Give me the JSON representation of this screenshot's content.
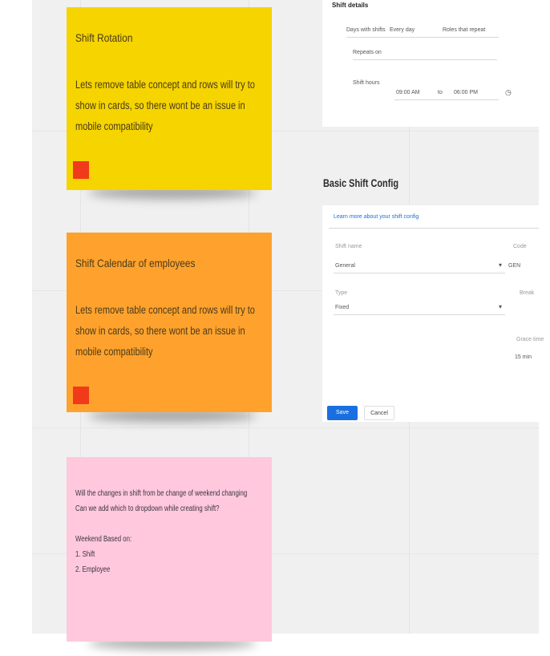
{
  "stickies": [
    {
      "title": "Shift Rotation",
      "body": "Lets remove table concept and rows will try to show in cards, so there wont be an issue in mobile compatibility"
    },
    {
      "title": "Shift Calendar of employees",
      "body": "Lets remove table concept and rows will try to show in cards, so there wont be an issue in mobile compatibility"
    },
    {
      "lines": [
        "Will the changes in shift from be change of weekend changing",
        "Can we add which to dropdown while creating shift?",
        "",
        "Weekend Based on:",
        "1. Shift",
        "2. Employee"
      ]
    }
  ],
  "top_panel": {
    "title": "Shift details",
    "row1_label": "Days with shifts",
    "row1_value": "Every day",
    "row1_right": "Roles that repeat",
    "row2_label": "Repeats on",
    "row3_label": "Shift hours",
    "row3_start": "09:00 AM",
    "row3_sep": "to",
    "row3_end": "06:00 PM"
  },
  "config": {
    "heading": "Basic Shift Config",
    "link": "Learn more about your shift config",
    "field1_label": "Shift name",
    "field1_value": "General",
    "field1_right_label": "Code",
    "field1_right_value": "GEN",
    "field2_label": "Type",
    "field2_value": "Fixed",
    "field2_right_label": "Break",
    "field3_label": "Grace time",
    "field3_value": "15 min",
    "primary_button": "Save",
    "secondary_button": "Cancel"
  },
  "colors": {
    "yellow": "#f5d400",
    "orange": "#ffa22d",
    "pink": "#ffc8dc",
    "red_tag": "#f13a1a",
    "primary": "#1a6fe0"
  }
}
